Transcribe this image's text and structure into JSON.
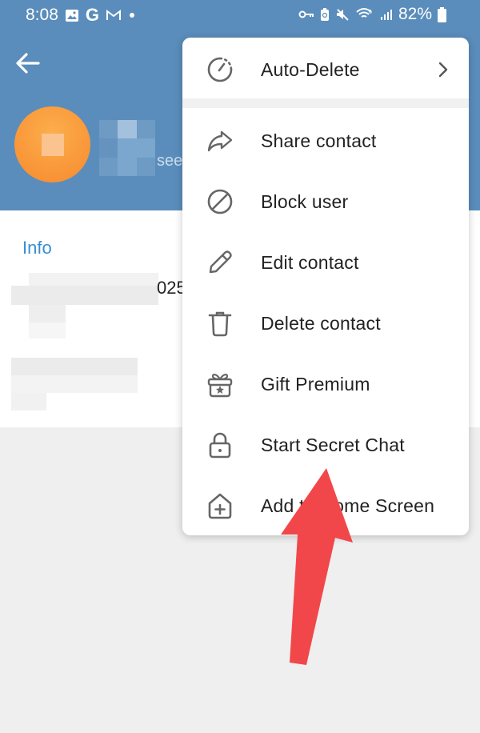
{
  "status_bar": {
    "time": "8:08",
    "left_icons": [
      "gallery-icon",
      "google-icon",
      "gmail-icon",
      "notification-dot"
    ],
    "google_letter": "G",
    "right_icons": [
      "vpn-key-icon",
      "battery-saver-icon",
      "mute-icon",
      "wifi-icon",
      "signal-icon"
    ],
    "battery_percent": "82%"
  },
  "header": {
    "back_icon": "arrow-left-icon",
    "last_seen_partial": "seen",
    "background_color": "#5a8dbb",
    "avatar_color": "#f9983a"
  },
  "info": {
    "title": "Info",
    "phone_partial": "025",
    "accent_color": "#3a8dd1"
  },
  "menu": {
    "items": [
      {
        "label": "Auto-Delete",
        "icon": "timer-icon",
        "has_submenu": true
      },
      {
        "label": "Share contact",
        "icon": "share-icon"
      },
      {
        "label": "Block user",
        "icon": "block-icon"
      },
      {
        "label": "Edit contact",
        "icon": "pencil-icon"
      },
      {
        "label": "Delete contact",
        "icon": "trash-icon"
      },
      {
        "label": "Gift Premium",
        "icon": "gift-icon"
      },
      {
        "label": "Start Secret Chat",
        "icon": "lock-icon"
      },
      {
        "label": "Add to Home Screen",
        "icon": "add-home-icon"
      }
    ]
  },
  "annotation": {
    "type": "arrow",
    "points_to": "Start Secret Chat",
    "color": "#f2474a"
  }
}
